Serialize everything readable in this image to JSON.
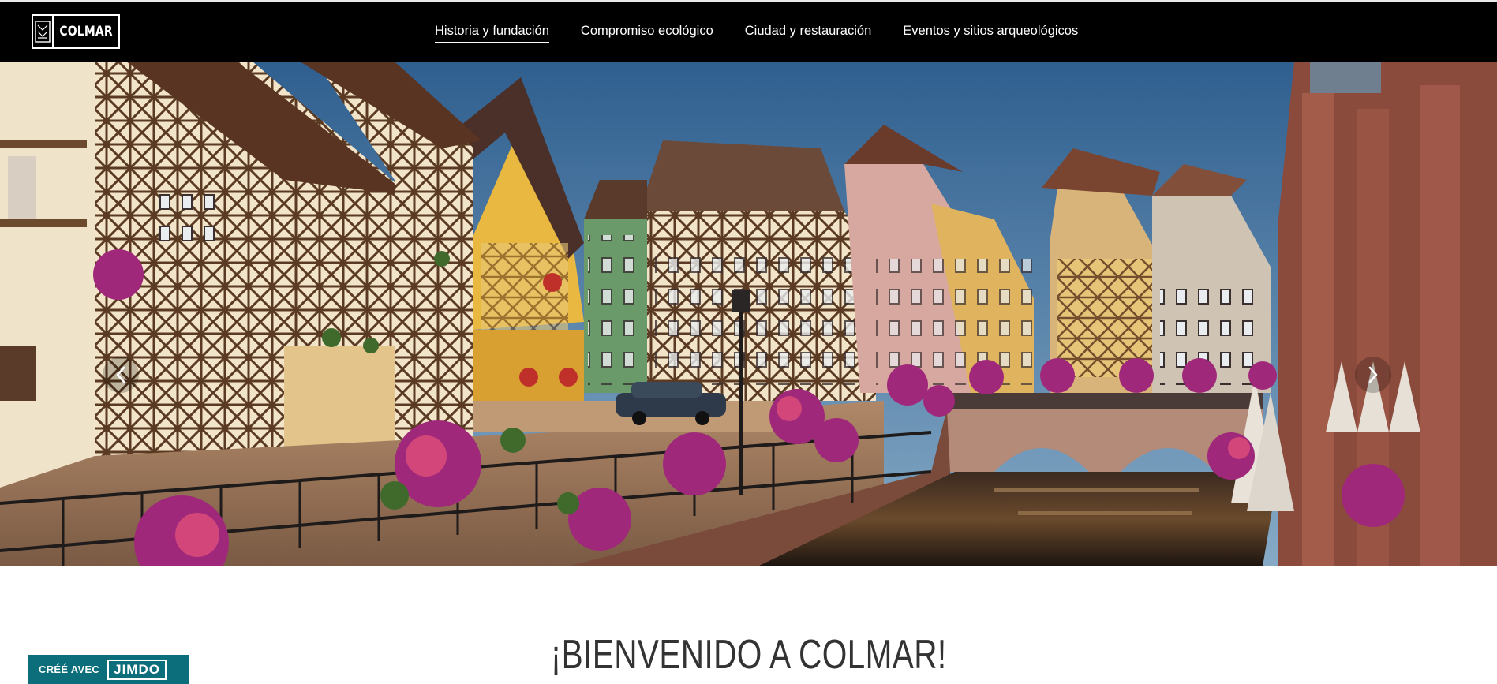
{
  "site": {
    "logo_text": "COLMAR",
    "logo_icon": "crest-icon"
  },
  "nav": {
    "items": [
      {
        "label": "Historia y fundación",
        "active": true
      },
      {
        "label": "Compromiso ecológico",
        "active": false
      },
      {
        "label": "Ciudad y restauración",
        "active": false
      },
      {
        "label": "Eventos y sitios arqueológicos",
        "active": false
      }
    ]
  },
  "hero": {
    "prev_icon": "chevron-left-icon",
    "next_icon": "chevron-right-icon"
  },
  "main": {
    "heading": "¡BIENVENIDO A COLMAR!"
  },
  "badge": {
    "prefix": "CRÉÉ AVEC",
    "brand": "JIMDO",
    "color": "#0b6e7a"
  }
}
